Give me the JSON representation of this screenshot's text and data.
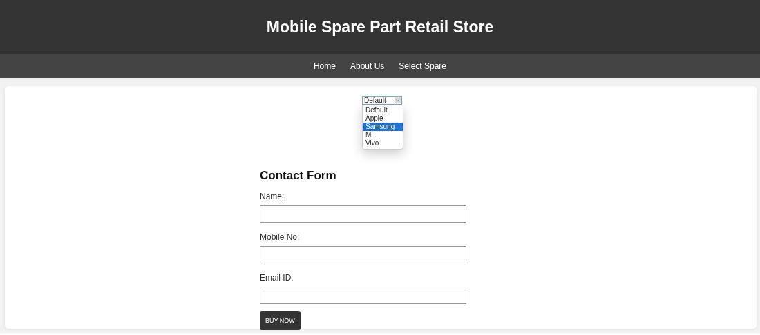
{
  "header": {
    "title": "Mobile Spare Part Retail Store"
  },
  "nav": [
    "Home",
    "About Us",
    "Select Spare"
  ],
  "select": {
    "value": "Default",
    "expanded": true,
    "options": [
      {
        "label": "Default",
        "highlighted": false
      },
      {
        "label": "Apple",
        "highlighted": false
      },
      {
        "label": "Samsung",
        "highlighted": true
      },
      {
        "label": "Mi",
        "highlighted": false
      },
      {
        "label": "Vivo",
        "highlighted": false
      }
    ]
  },
  "form": {
    "title": "Contact Form",
    "fields": [
      {
        "label": "Name:"
      },
      {
        "label": "Mobile No:"
      },
      {
        "label": "Email ID:"
      }
    ],
    "button": "BUY NOW"
  }
}
